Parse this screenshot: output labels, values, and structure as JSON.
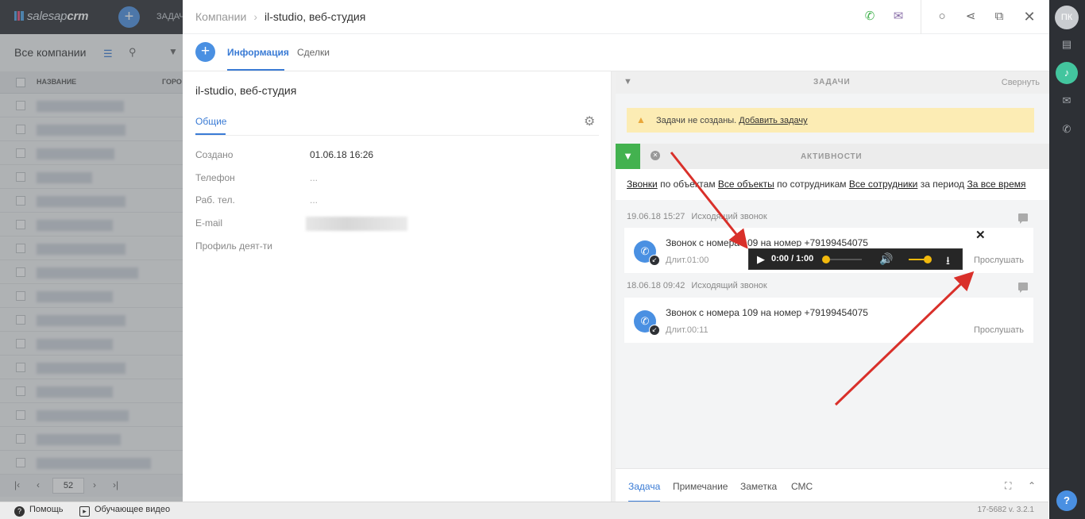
{
  "app": {
    "brand_plain": "salesap",
    "brand_bold": "crm",
    "tasks_cut": "ЗАДАЧ",
    "user_initials": "ПК"
  },
  "bg": {
    "title": "Все компании",
    "col_name": "НАЗВАНИЕ",
    "col_city": "ГОРО",
    "page": "52",
    "row_count": 16
  },
  "breadcrumb": {
    "parent": "Компании",
    "current": "il-studio, веб-студия"
  },
  "tabs": {
    "info": "Информация",
    "deals": "Сделки"
  },
  "company": {
    "name": "il-studio, веб-студия",
    "sub_tab": "Общие",
    "fields": [
      {
        "label": "Создано",
        "value": "01.06.18 16:26"
      },
      {
        "label": "Телефон",
        "value": "..."
      },
      {
        "label": "Раб. тел.",
        "value": "..."
      },
      {
        "label": "E-mail",
        "value": ""
      },
      {
        "label": "Профиль деят-ти",
        "value": ""
      }
    ]
  },
  "tasks": {
    "title": "ЗАДАЧИ",
    "collapse": "Свернуть",
    "alert_text": "Задачи не созданы.",
    "alert_link": "Добавить задачу"
  },
  "activity": {
    "title": "АКТИВНОСТИ",
    "filters": {
      "calls": "Звонки",
      "by_objects": " по объектам ",
      "all_objects": "Все объекты",
      "by_staff": " по сотрудникам ",
      "all_staff": "Все сотрудники",
      "period": " за период ",
      "all_time": "За все время"
    },
    "items": [
      {
        "date": "19.06.18 15:27",
        "type": "Исходящий звонок",
        "title": "Звонок с номера 109 на номер +79199454075",
        "duration": "Длит.01:00",
        "listen": "Прослушать"
      },
      {
        "date": "18.06.18 09:42",
        "type": "Исходящий звонок",
        "title": "Звонок с номера 109 на номер +79199454075",
        "duration": "Длит.00:11",
        "listen": "Прослушать"
      }
    ]
  },
  "bottom_tabs": {
    "task": "Задача",
    "note": "Примечание",
    "memo": "Заметка",
    "sms": "СМС"
  },
  "player": {
    "time": "0:00 / 1:00",
    "progress": 0,
    "volume": 1
  },
  "status": {
    "help": "Помощь",
    "video": "Обучающее видео",
    "version": "17-5682  v. 3.2.1"
  },
  "colors": {
    "accent": "#3a7bd5",
    "green": "#43b24f",
    "alert": "#fcecb4",
    "arrow": "#d9302a",
    "player_knob": "#f2b90d"
  },
  "icons": [
    "phone-icon",
    "mail-icon",
    "circle-icon",
    "share-icon",
    "external-link-icon",
    "close-icon",
    "gear-icon",
    "filter-icon",
    "warning-icon",
    "comment-icon",
    "play-icon",
    "volume-icon",
    "download-icon",
    "expand-icon",
    "chevron-up-icon",
    "help-icon"
  ]
}
